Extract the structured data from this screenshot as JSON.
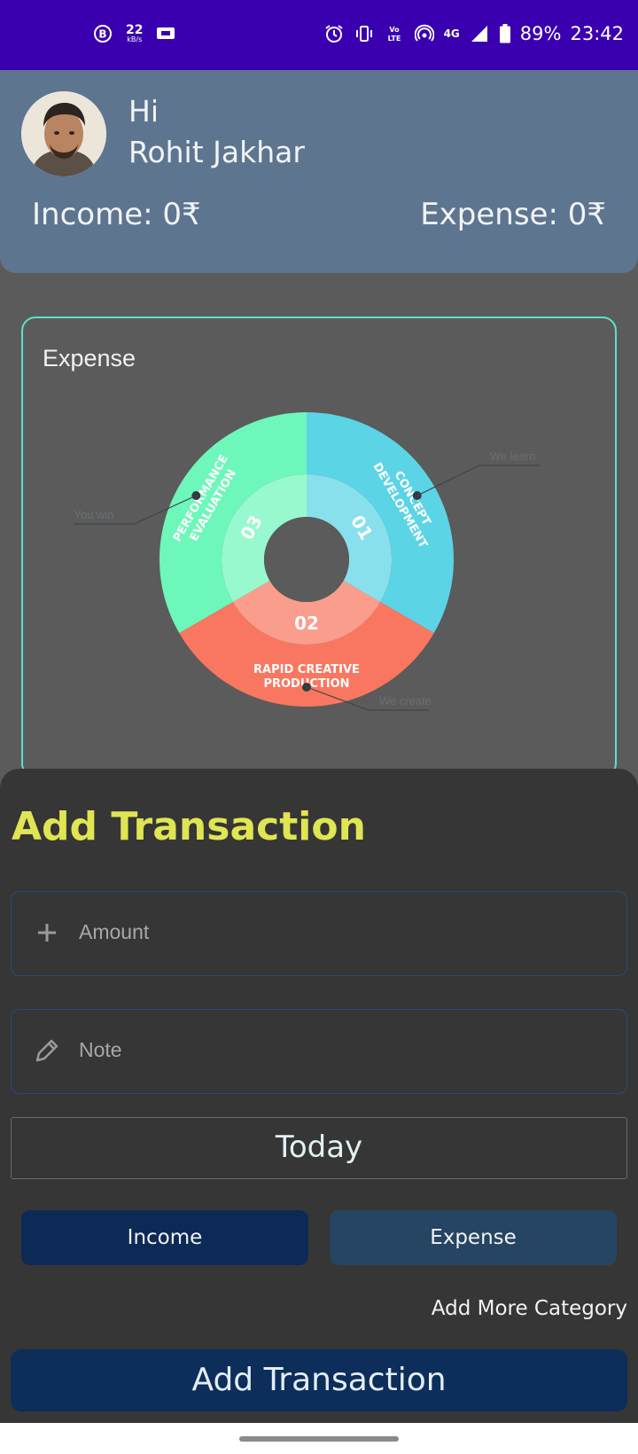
{
  "status_bar": {
    "net_speed_value": "22",
    "net_speed_unit": "kB/s",
    "battery": "89%",
    "time": "23:42",
    "network": "4G",
    "volte": "LTE",
    "icons": [
      "b-icon",
      "cast-icon",
      "alarm-icon",
      "vibrate-icon",
      "volte-icon",
      "hotspot-icon",
      "signal-icon",
      "battery-icon"
    ]
  },
  "header": {
    "greeting": "Hi",
    "user_name": "Rohit Jakhar",
    "income_label": "Income: 0₹",
    "expense_label": "Expense: 0₹"
  },
  "chart_card": {
    "title": "Expense"
  },
  "chart_data": {
    "type": "pie",
    "segments": [
      {
        "number": "01",
        "label": "CONCEPT DEVELOPMENT",
        "callout": "We learn",
        "color": "#5bd4e6",
        "share": 0.3333
      },
      {
        "number": "02",
        "label": "RAPID CREATIVE PRODUCTION",
        "callout": "We create",
        "color": "#f97760",
        "share": 0.3333
      },
      {
        "number": "03",
        "label": "PERFORMANCE EVALUATION",
        "callout": "You win",
        "color": "#6ef7ba",
        "share": 0.3333
      }
    ]
  },
  "sheet": {
    "title": "Add Transaction",
    "amount_placeholder": "Amount",
    "note_placeholder": "Note",
    "date_label": "Today",
    "income_button": "Income",
    "expense_button": "Expense",
    "add_category_link": "Add More Category",
    "submit_button": "Add Transaction"
  }
}
